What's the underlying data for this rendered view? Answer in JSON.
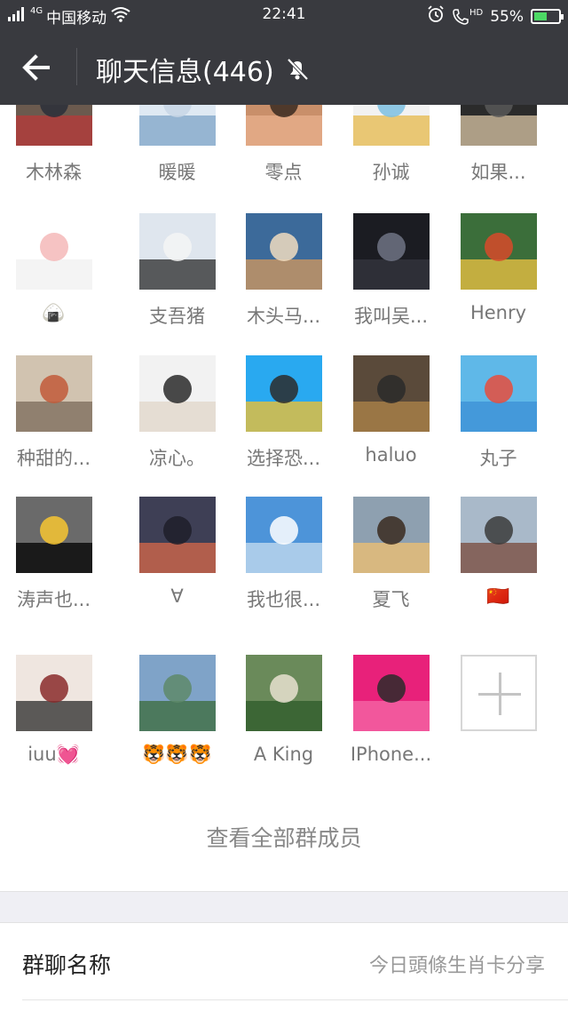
{
  "status_bar": {
    "network": "4G",
    "carrier": "中国移动",
    "time": "22:41",
    "hd": "HD",
    "battery": "55%",
    "battery_level": 0.55,
    "icons": [
      "signal-icon",
      "wifi-icon",
      "alarm-icon",
      "hd-call-icon",
      "battery-icon"
    ]
  },
  "header": {
    "title": "聊天信息(446)",
    "back_icon": "arrow-left-icon",
    "mute_icon": "bell-muted-icon"
  },
  "members": [
    {
      "name": "木林森"
    },
    {
      "name": "暖暖"
    },
    {
      "name": "零点"
    },
    {
      "name": "孙诚"
    },
    {
      "name": "如果..."
    },
    {
      "name": "🍙"
    },
    {
      "name": "支吾猪"
    },
    {
      "name": "木头马..."
    },
    {
      "name": "我叫吴..."
    },
    {
      "name": "Henry"
    },
    {
      "name": "种甜的..."
    },
    {
      "name": "凉心。"
    },
    {
      "name": "选择恐..."
    },
    {
      "name": "haluo"
    },
    {
      "name": "丸子"
    },
    {
      "name": "涛声也..."
    },
    {
      "name": "∀"
    },
    {
      "name": "我也很..."
    },
    {
      "name": "夏飞"
    },
    {
      "name": "🇨🇳"
    },
    {
      "name": "iuu💓"
    },
    {
      "name": "🐯🐯🐯"
    },
    {
      "name": "A King"
    },
    {
      "name": "IPhone..."
    }
  ],
  "view_all_label": "查看全部群成员",
  "group_name": {
    "label": "群聊名称",
    "value": "今日頭條生肖卡分享"
  }
}
